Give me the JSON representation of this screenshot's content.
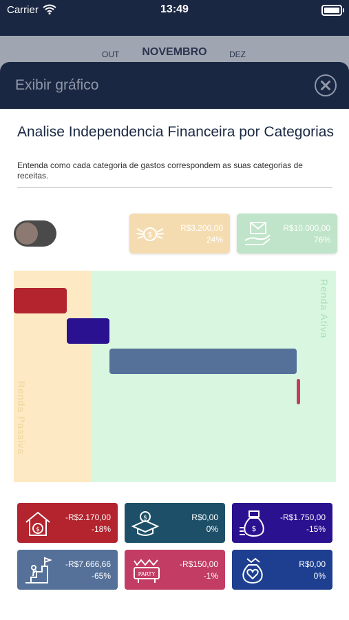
{
  "status": {
    "carrier": "Carrier",
    "time": "13:49"
  },
  "months": {
    "prev": "OUT",
    "current": "NOVEMBRO",
    "next": "DEZ"
  },
  "sheet": {
    "title": "Exibir gráfico"
  },
  "analysis": {
    "title": "Analise Independencia Financeira por Categorias",
    "subtitle": "Entenda como cada categoria de gastos correspondem as suas categorias de receitas."
  },
  "toggle": {
    "on": false
  },
  "summary": [
    {
      "value": "R$3.200,00",
      "percent": "24%",
      "icon": "winged-coin-icon",
      "color": "#f5dcb0"
    },
    {
      "value": "R$10.000,00",
      "percent": "76%",
      "icon": "salary-hand-icon",
      "color": "#bfe4c9"
    }
  ],
  "chart_data": {
    "type": "bar",
    "orientation": "horizontal-waterfall",
    "zones": [
      {
        "name": "Renda Passiva",
        "value": 3200,
        "percent": 24,
        "color": "#fde9c3"
      },
      {
        "name": "Renda Ativa",
        "value": 10000,
        "percent": 76,
        "color": "#d9f7e0"
      }
    ],
    "total": 13200,
    "bars": [
      {
        "category": "Moradia",
        "value": 2170,
        "color": "#b3242e"
      },
      {
        "category": "Educação",
        "value": 0,
        "color": "#1d5068"
      },
      {
        "category": "Investimentos",
        "value": 1750,
        "color": "#2a1190"
      },
      {
        "category": "Metas",
        "value": 7666.66,
        "color": "#557199"
      },
      {
        "category": "Lazer",
        "value": 150,
        "color": "#c23c63"
      },
      {
        "category": "Cuidados",
        "value": 0,
        "color": "#1e3f8f"
      }
    ]
  },
  "categories": [
    {
      "value": "-R$2.170,00",
      "percent": "-18%",
      "icon": "house-money-icon",
      "color": "#b3242e"
    },
    {
      "value": "R$0,00",
      "percent": "0%",
      "icon": "graduation-cap-icon",
      "color": "#1d5068"
    },
    {
      "value": "-R$1.750,00",
      "percent": "-15%",
      "icon": "money-bag-icon",
      "color": "#2a1190"
    },
    {
      "value": "-R$7.666,66",
      "percent": "-65%",
      "icon": "stairs-goal-icon",
      "color": "#557199"
    },
    {
      "value": "-R$150,00",
      "percent": "-1%",
      "icon": "party-sign-icon",
      "color": "#c23c63"
    },
    {
      "value": "R$0,00",
      "percent": "0%",
      "icon": "heart-bag-icon",
      "color": "#1e3f8f"
    }
  ]
}
